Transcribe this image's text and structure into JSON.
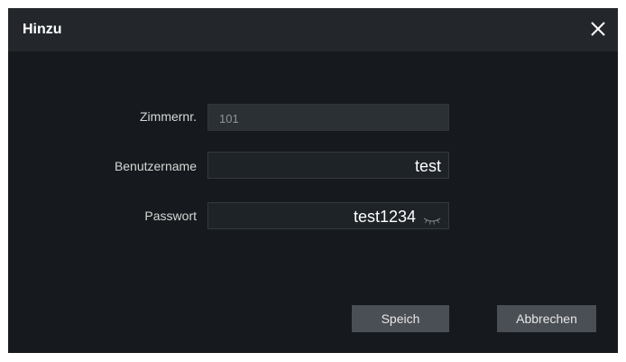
{
  "dialog": {
    "title": "Hinzu",
    "close_icon": "close-icon"
  },
  "form": {
    "room": {
      "label": "Zimmernr.",
      "value": "101",
      "disabled": true
    },
    "username": {
      "label": "Benutzername",
      "value": "test"
    },
    "password": {
      "label": "Passwort",
      "value": "test1234",
      "toggle_icon": "eye-closed-icon"
    }
  },
  "buttons": {
    "save_label": "Speich",
    "cancel_label": "Abbrechen"
  },
  "colors": {
    "dialog_bg": "#161a1e",
    "titlebar_bg": "#23272c",
    "button_bg": "#4a4f55"
  }
}
